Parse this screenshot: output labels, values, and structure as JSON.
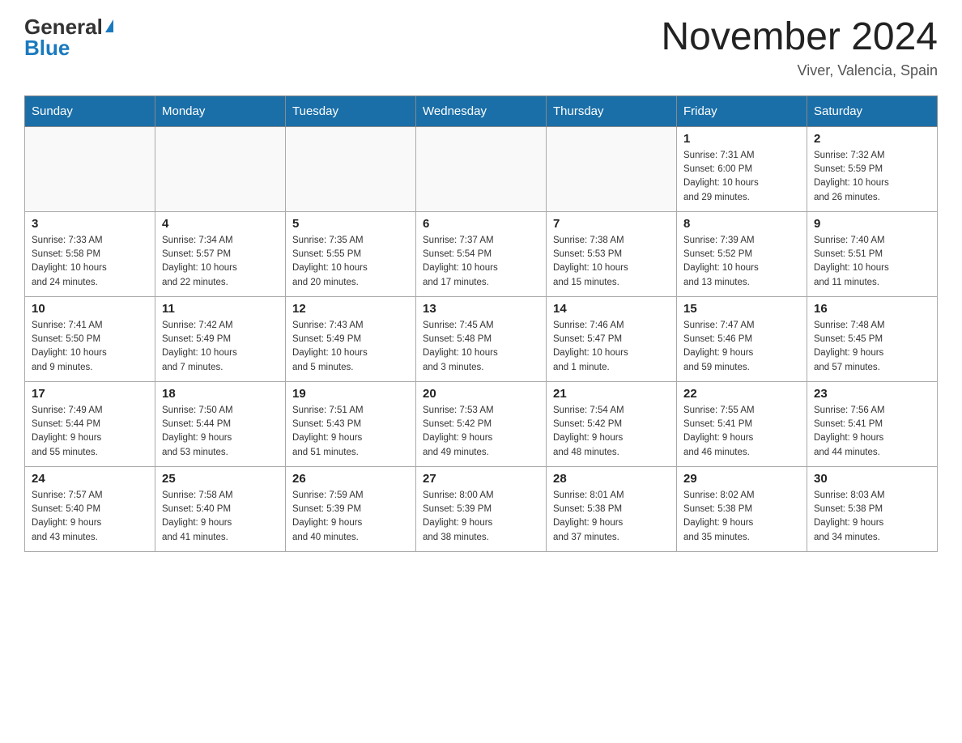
{
  "header": {
    "logo_general": "General",
    "logo_blue": "Blue",
    "month_title": "November 2024",
    "location": "Viver, Valencia, Spain"
  },
  "weekdays": [
    "Sunday",
    "Monday",
    "Tuesday",
    "Wednesday",
    "Thursday",
    "Friday",
    "Saturday"
  ],
  "weeks": [
    [
      {
        "day": "",
        "info": ""
      },
      {
        "day": "",
        "info": ""
      },
      {
        "day": "",
        "info": ""
      },
      {
        "day": "",
        "info": ""
      },
      {
        "day": "",
        "info": ""
      },
      {
        "day": "1",
        "info": "Sunrise: 7:31 AM\nSunset: 6:00 PM\nDaylight: 10 hours\nand 29 minutes."
      },
      {
        "day": "2",
        "info": "Sunrise: 7:32 AM\nSunset: 5:59 PM\nDaylight: 10 hours\nand 26 minutes."
      }
    ],
    [
      {
        "day": "3",
        "info": "Sunrise: 7:33 AM\nSunset: 5:58 PM\nDaylight: 10 hours\nand 24 minutes."
      },
      {
        "day": "4",
        "info": "Sunrise: 7:34 AM\nSunset: 5:57 PM\nDaylight: 10 hours\nand 22 minutes."
      },
      {
        "day": "5",
        "info": "Sunrise: 7:35 AM\nSunset: 5:55 PM\nDaylight: 10 hours\nand 20 minutes."
      },
      {
        "day": "6",
        "info": "Sunrise: 7:37 AM\nSunset: 5:54 PM\nDaylight: 10 hours\nand 17 minutes."
      },
      {
        "day": "7",
        "info": "Sunrise: 7:38 AM\nSunset: 5:53 PM\nDaylight: 10 hours\nand 15 minutes."
      },
      {
        "day": "8",
        "info": "Sunrise: 7:39 AM\nSunset: 5:52 PM\nDaylight: 10 hours\nand 13 minutes."
      },
      {
        "day": "9",
        "info": "Sunrise: 7:40 AM\nSunset: 5:51 PM\nDaylight: 10 hours\nand 11 minutes."
      }
    ],
    [
      {
        "day": "10",
        "info": "Sunrise: 7:41 AM\nSunset: 5:50 PM\nDaylight: 10 hours\nand 9 minutes."
      },
      {
        "day": "11",
        "info": "Sunrise: 7:42 AM\nSunset: 5:49 PM\nDaylight: 10 hours\nand 7 minutes."
      },
      {
        "day": "12",
        "info": "Sunrise: 7:43 AM\nSunset: 5:49 PM\nDaylight: 10 hours\nand 5 minutes."
      },
      {
        "day": "13",
        "info": "Sunrise: 7:45 AM\nSunset: 5:48 PM\nDaylight: 10 hours\nand 3 minutes."
      },
      {
        "day": "14",
        "info": "Sunrise: 7:46 AM\nSunset: 5:47 PM\nDaylight: 10 hours\nand 1 minute."
      },
      {
        "day": "15",
        "info": "Sunrise: 7:47 AM\nSunset: 5:46 PM\nDaylight: 9 hours\nand 59 minutes."
      },
      {
        "day": "16",
        "info": "Sunrise: 7:48 AM\nSunset: 5:45 PM\nDaylight: 9 hours\nand 57 minutes."
      }
    ],
    [
      {
        "day": "17",
        "info": "Sunrise: 7:49 AM\nSunset: 5:44 PM\nDaylight: 9 hours\nand 55 minutes."
      },
      {
        "day": "18",
        "info": "Sunrise: 7:50 AM\nSunset: 5:44 PM\nDaylight: 9 hours\nand 53 minutes."
      },
      {
        "day": "19",
        "info": "Sunrise: 7:51 AM\nSunset: 5:43 PM\nDaylight: 9 hours\nand 51 minutes."
      },
      {
        "day": "20",
        "info": "Sunrise: 7:53 AM\nSunset: 5:42 PM\nDaylight: 9 hours\nand 49 minutes."
      },
      {
        "day": "21",
        "info": "Sunrise: 7:54 AM\nSunset: 5:42 PM\nDaylight: 9 hours\nand 48 minutes."
      },
      {
        "day": "22",
        "info": "Sunrise: 7:55 AM\nSunset: 5:41 PM\nDaylight: 9 hours\nand 46 minutes."
      },
      {
        "day": "23",
        "info": "Sunrise: 7:56 AM\nSunset: 5:41 PM\nDaylight: 9 hours\nand 44 minutes."
      }
    ],
    [
      {
        "day": "24",
        "info": "Sunrise: 7:57 AM\nSunset: 5:40 PM\nDaylight: 9 hours\nand 43 minutes."
      },
      {
        "day": "25",
        "info": "Sunrise: 7:58 AM\nSunset: 5:40 PM\nDaylight: 9 hours\nand 41 minutes."
      },
      {
        "day": "26",
        "info": "Sunrise: 7:59 AM\nSunset: 5:39 PM\nDaylight: 9 hours\nand 40 minutes."
      },
      {
        "day": "27",
        "info": "Sunrise: 8:00 AM\nSunset: 5:39 PM\nDaylight: 9 hours\nand 38 minutes."
      },
      {
        "day": "28",
        "info": "Sunrise: 8:01 AM\nSunset: 5:38 PM\nDaylight: 9 hours\nand 37 minutes."
      },
      {
        "day": "29",
        "info": "Sunrise: 8:02 AM\nSunset: 5:38 PM\nDaylight: 9 hours\nand 35 minutes."
      },
      {
        "day": "30",
        "info": "Sunrise: 8:03 AM\nSunset: 5:38 PM\nDaylight: 9 hours\nand 34 minutes."
      }
    ]
  ]
}
